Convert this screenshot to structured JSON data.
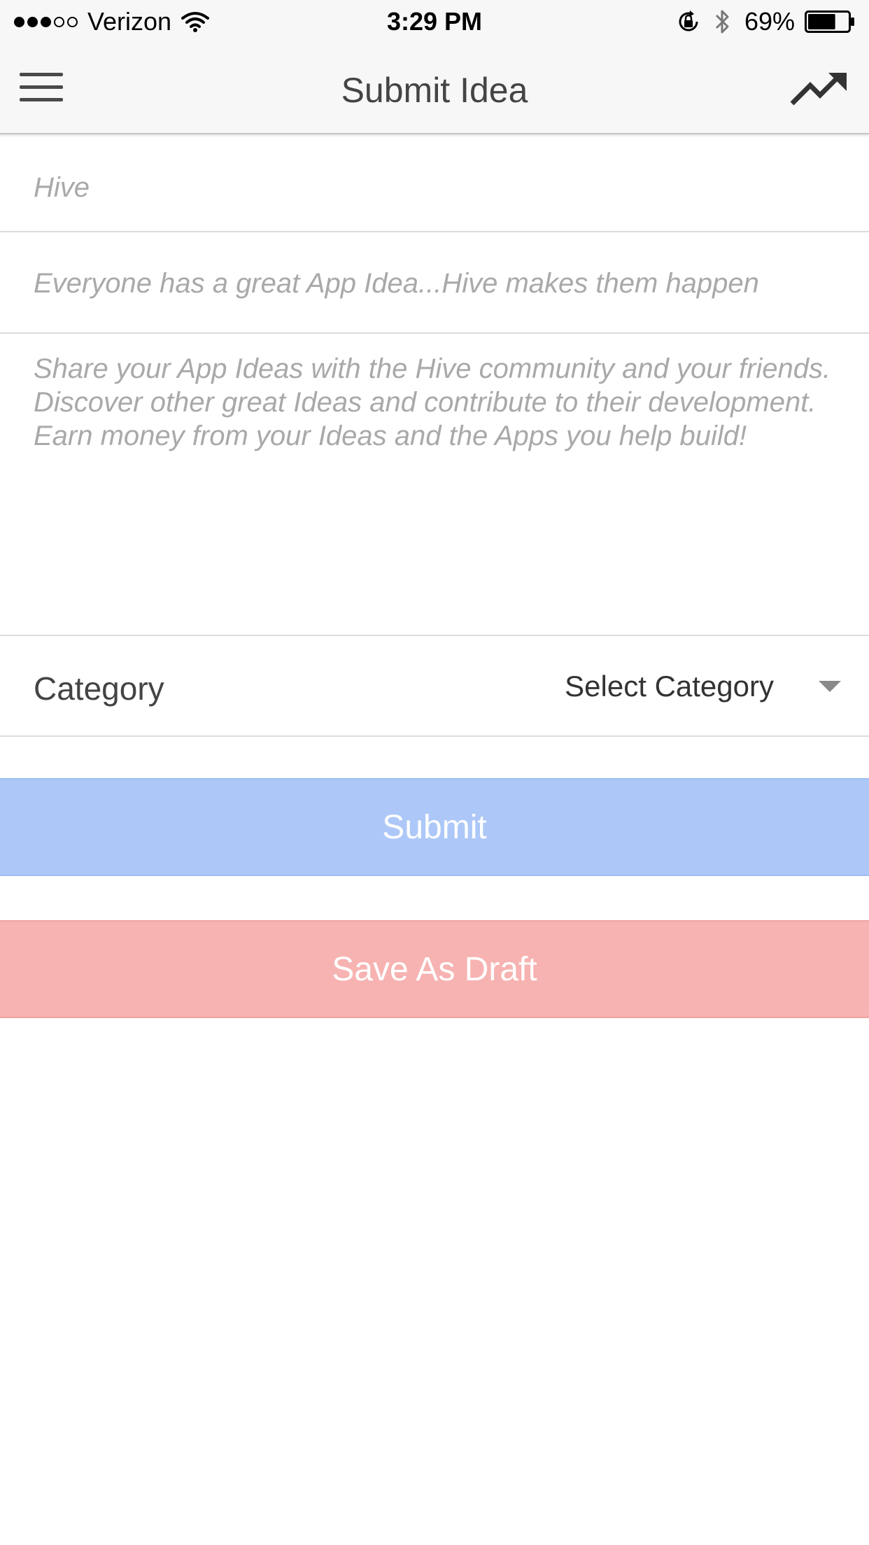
{
  "status_bar": {
    "signal": {
      "filled": 3,
      "total": 5
    },
    "carrier": "Verizon",
    "time": "3:29 PM",
    "battery_percent": "69%",
    "battery_level": 0.69,
    "icons": [
      "wifi-icon",
      "rotation-lock-icon",
      "bluetooth-icon",
      "battery-icon"
    ]
  },
  "nav": {
    "title": "Submit Idea",
    "left_icon": "menu-icon",
    "right_icon": "trending-icon"
  },
  "form": {
    "title_placeholder": "Hive",
    "title_value": "",
    "tagline_placeholder": "Everyone has a great App Idea...Hive makes them happen",
    "tagline_value": "",
    "description_placeholder": "Share your App Ideas with the Hive community and your friends. Discover other great Ideas and contribute to their development. Earn money from your Ideas and the Apps you help build!",
    "description_value": "",
    "category_label": "Category",
    "category_value": "Select Category"
  },
  "buttons": {
    "submit_label": "Submit",
    "draft_label": "Save As Draft"
  },
  "colors": {
    "submit_bg": "#adc8f8",
    "draft_bg": "#f7b3b1",
    "bar_bg": "#f7f7f7"
  }
}
